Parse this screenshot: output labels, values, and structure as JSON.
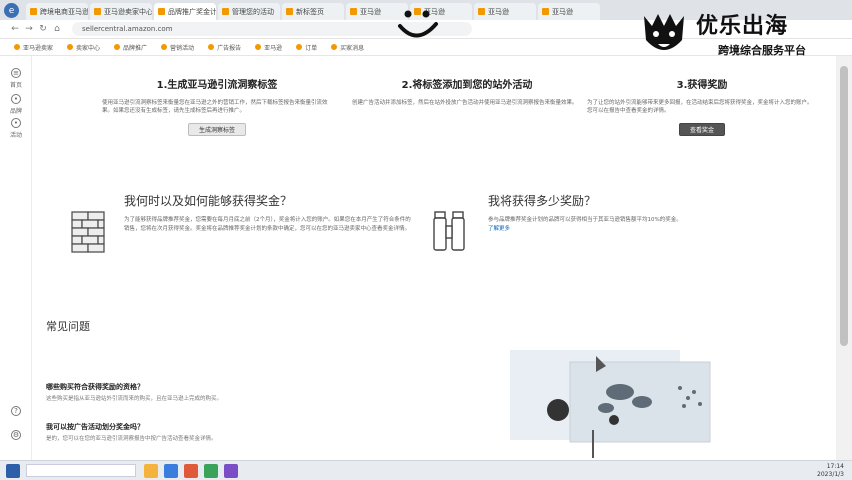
{
  "browser": {
    "tabs": [
      "跨境电商亚马逊卖家",
      "亚马逊卖家中心",
      "品牌推广奖金计划",
      "管理您的活动",
      "新标签页",
      "亚马逊",
      "亚马逊",
      "亚马逊",
      "亚马逊"
    ],
    "url": "sellercentral.amazon.com",
    "bookmarks": [
      "亚马逊卖家",
      "卖家中心",
      "品牌推广",
      "营销活动",
      "广告报告",
      "亚马逊",
      "订单",
      "买家消息"
    ]
  },
  "rail": [
    "首页",
    "品牌",
    "活动"
  ],
  "steps": [
    {
      "title": "1.生成亚马逊引流洞察标签",
      "desc": "使用亚马逊引流洞察标签来衡量您在亚马逊之外的营销工作，然后下载标签报告来衡量引流效果。如果您还没有生成标签，请先生成标签后再进行推广。",
      "button": "生成洞察标签"
    },
    {
      "title": "2.将标签添加到您的站外活动",
      "desc": "创建广告活动并添加标签，然后在站外投放广告活动并使用亚马逊引流洞察报告来衡量效果。",
      "button": ""
    },
    {
      "title": "3.获得奖励",
      "desc": "为了让您的站外引流能够带来更多回报，在活动结束后您将获得奖金，奖金将计入您的账户。您可以在报告中查看奖金的详情。",
      "button": "查看奖金"
    }
  ],
  "how": {
    "title": "我何时以及如何能够获得奖金？",
    "text": "为了能够获得品牌推荐奖金，您需要在每月月底之前（2个月），奖金将计入您的账户。如果您在本月产生了符合条件的销售，您将在次月获得奖金。奖金将在品牌推荐奖金计划的条款中确定，您可以在您的亚马逊卖家中心查看奖金详情。"
  },
  "reward": {
    "title": "我将获得多少奖励？",
    "text": "参与品牌推荐奖金计划的品牌可以获得相当于其亚马逊销售额平均10%的奖金。",
    "link": "了解更多"
  },
  "faq": {
    "title": "常见问题",
    "items": [
      {
        "q": "哪些购买符合获得奖励的资格？",
        "a": "这些购买是指从亚马逊站外引流而来的购买，且在亚马逊上完成的购买。"
      },
      {
        "q": "我可以按广告活动划分奖金吗？",
        "a": "是的，您可以在您的亚马逊引流洞察报告中按广告活动查看奖金详情。"
      }
    ]
  },
  "brand": {
    "title": "优乐出海",
    "subtitle": "跨境综合服务平台"
  },
  "taskbar": {
    "time": "17:14",
    "date": "2023/1/3"
  }
}
